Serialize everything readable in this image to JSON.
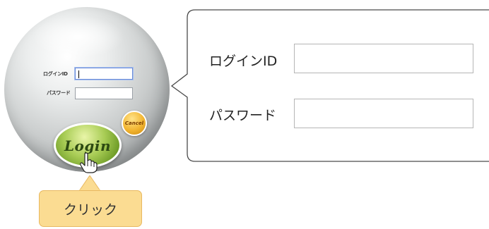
{
  "widget": {
    "login_id_label": "ログインID",
    "password_label": "パスワード",
    "login_id_value": "",
    "password_value": "",
    "login_button": "Login",
    "cancel_button": "Cancel"
  },
  "tooltip": {
    "text": "クリック"
  },
  "zoom": {
    "login_id_label": "ログインID",
    "password_label": "パスワード",
    "login_id_value": "",
    "password_value": ""
  },
  "colors": {
    "login_button": "#8fbf3f",
    "cancel_button": "#f2b531",
    "tooltip_bg": "#fbdc92"
  },
  "icons": [
    "pointer-hand-icon"
  ]
}
